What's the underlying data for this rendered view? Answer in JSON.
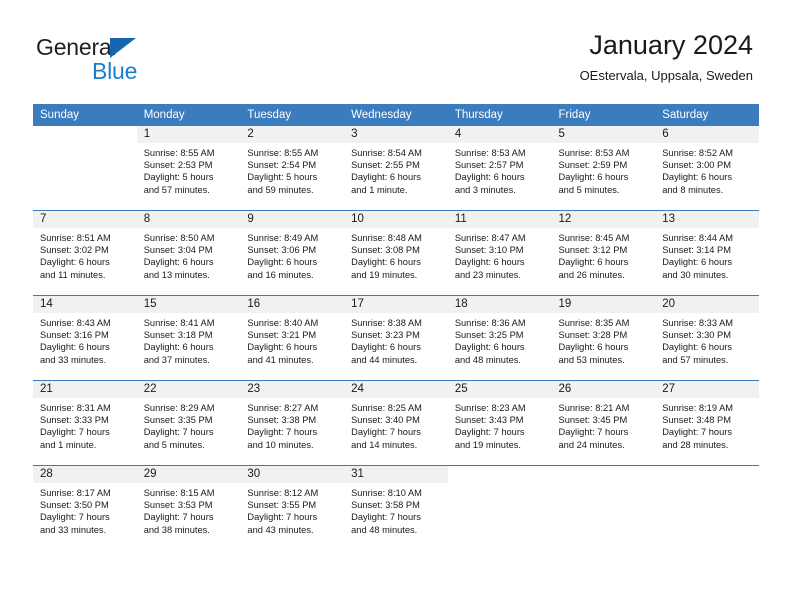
{
  "brand": {
    "name_part1": "General",
    "name_part2": "Blue",
    "triangle_color": "#1565b0",
    "blue_color": "#1b7ec8"
  },
  "header": {
    "title": "January 2024",
    "location": "OEstervala, Uppsala, Sweden"
  },
  "theme": {
    "header_row_bg": "#3a7cbe",
    "header_row_text": "#ffffff",
    "daynum_band_bg": "#f1f1f1",
    "cell_bg": "#ffffff",
    "separator": "#3a7cbe"
  },
  "weekday_headers": [
    "Sunday",
    "Monday",
    "Tuesday",
    "Wednesday",
    "Thursday",
    "Friday",
    "Saturday"
  ],
  "weeks": [
    [
      {
        "day": "",
        "blank": true,
        "sunrise": "",
        "sunset": "",
        "daylight_line1": "",
        "daylight_line2": ""
      },
      {
        "day": "1",
        "sunrise": "Sunrise: 8:55 AM",
        "sunset": "Sunset: 2:53 PM",
        "daylight_line1": "Daylight: 5 hours",
        "daylight_line2": "and 57 minutes."
      },
      {
        "day": "2",
        "sunrise": "Sunrise: 8:55 AM",
        "sunset": "Sunset: 2:54 PM",
        "daylight_line1": "Daylight: 5 hours",
        "daylight_line2": "and 59 minutes."
      },
      {
        "day": "3",
        "sunrise": "Sunrise: 8:54 AM",
        "sunset": "Sunset: 2:55 PM",
        "daylight_line1": "Daylight: 6 hours",
        "daylight_line2": "and 1 minute."
      },
      {
        "day": "4",
        "sunrise": "Sunrise: 8:53 AM",
        "sunset": "Sunset: 2:57 PM",
        "daylight_line1": "Daylight: 6 hours",
        "daylight_line2": "and 3 minutes."
      },
      {
        "day": "5",
        "sunrise": "Sunrise: 8:53 AM",
        "sunset": "Sunset: 2:59 PM",
        "daylight_line1": "Daylight: 6 hours",
        "daylight_line2": "and 5 minutes."
      },
      {
        "day": "6",
        "sunrise": "Sunrise: 8:52 AM",
        "sunset": "Sunset: 3:00 PM",
        "daylight_line1": "Daylight: 6 hours",
        "daylight_line2": "and 8 minutes."
      }
    ],
    [
      {
        "day": "7",
        "sunrise": "Sunrise: 8:51 AM",
        "sunset": "Sunset: 3:02 PM",
        "daylight_line1": "Daylight: 6 hours",
        "daylight_line2": "and 11 minutes."
      },
      {
        "day": "8",
        "sunrise": "Sunrise: 8:50 AM",
        "sunset": "Sunset: 3:04 PM",
        "daylight_line1": "Daylight: 6 hours",
        "daylight_line2": "and 13 minutes."
      },
      {
        "day": "9",
        "sunrise": "Sunrise: 8:49 AM",
        "sunset": "Sunset: 3:06 PM",
        "daylight_line1": "Daylight: 6 hours",
        "daylight_line2": "and 16 minutes."
      },
      {
        "day": "10",
        "sunrise": "Sunrise: 8:48 AM",
        "sunset": "Sunset: 3:08 PM",
        "daylight_line1": "Daylight: 6 hours",
        "daylight_line2": "and 19 minutes."
      },
      {
        "day": "11",
        "sunrise": "Sunrise: 8:47 AM",
        "sunset": "Sunset: 3:10 PM",
        "daylight_line1": "Daylight: 6 hours",
        "daylight_line2": "and 23 minutes."
      },
      {
        "day": "12",
        "sunrise": "Sunrise: 8:45 AM",
        "sunset": "Sunset: 3:12 PM",
        "daylight_line1": "Daylight: 6 hours",
        "daylight_line2": "and 26 minutes."
      },
      {
        "day": "13",
        "sunrise": "Sunrise: 8:44 AM",
        "sunset": "Sunset: 3:14 PM",
        "daylight_line1": "Daylight: 6 hours",
        "daylight_line2": "and 30 minutes."
      }
    ],
    [
      {
        "day": "14",
        "sunrise": "Sunrise: 8:43 AM",
        "sunset": "Sunset: 3:16 PM",
        "daylight_line1": "Daylight: 6 hours",
        "daylight_line2": "and 33 minutes."
      },
      {
        "day": "15",
        "sunrise": "Sunrise: 8:41 AM",
        "sunset": "Sunset: 3:18 PM",
        "daylight_line1": "Daylight: 6 hours",
        "daylight_line2": "and 37 minutes."
      },
      {
        "day": "16",
        "sunrise": "Sunrise: 8:40 AM",
        "sunset": "Sunset: 3:21 PM",
        "daylight_line1": "Daylight: 6 hours",
        "daylight_line2": "and 41 minutes."
      },
      {
        "day": "17",
        "sunrise": "Sunrise: 8:38 AM",
        "sunset": "Sunset: 3:23 PM",
        "daylight_line1": "Daylight: 6 hours",
        "daylight_line2": "and 44 minutes."
      },
      {
        "day": "18",
        "sunrise": "Sunrise: 8:36 AM",
        "sunset": "Sunset: 3:25 PM",
        "daylight_line1": "Daylight: 6 hours",
        "daylight_line2": "and 48 minutes."
      },
      {
        "day": "19",
        "sunrise": "Sunrise: 8:35 AM",
        "sunset": "Sunset: 3:28 PM",
        "daylight_line1": "Daylight: 6 hours",
        "daylight_line2": "and 53 minutes."
      },
      {
        "day": "20",
        "sunrise": "Sunrise: 8:33 AM",
        "sunset": "Sunset: 3:30 PM",
        "daylight_line1": "Daylight: 6 hours",
        "daylight_line2": "and 57 minutes."
      }
    ],
    [
      {
        "day": "21",
        "sunrise": "Sunrise: 8:31 AM",
        "sunset": "Sunset: 3:33 PM",
        "daylight_line1": "Daylight: 7 hours",
        "daylight_line2": "and 1 minute."
      },
      {
        "day": "22",
        "sunrise": "Sunrise: 8:29 AM",
        "sunset": "Sunset: 3:35 PM",
        "daylight_line1": "Daylight: 7 hours",
        "daylight_line2": "and 5 minutes."
      },
      {
        "day": "23",
        "sunrise": "Sunrise: 8:27 AM",
        "sunset": "Sunset: 3:38 PM",
        "daylight_line1": "Daylight: 7 hours",
        "daylight_line2": "and 10 minutes."
      },
      {
        "day": "24",
        "sunrise": "Sunrise: 8:25 AM",
        "sunset": "Sunset: 3:40 PM",
        "daylight_line1": "Daylight: 7 hours",
        "daylight_line2": "and 14 minutes."
      },
      {
        "day": "25",
        "sunrise": "Sunrise: 8:23 AM",
        "sunset": "Sunset: 3:43 PM",
        "daylight_line1": "Daylight: 7 hours",
        "daylight_line2": "and 19 minutes."
      },
      {
        "day": "26",
        "sunrise": "Sunrise: 8:21 AM",
        "sunset": "Sunset: 3:45 PM",
        "daylight_line1": "Daylight: 7 hours",
        "daylight_line2": "and 24 minutes."
      },
      {
        "day": "27",
        "sunrise": "Sunrise: 8:19 AM",
        "sunset": "Sunset: 3:48 PM",
        "daylight_line1": "Daylight: 7 hours",
        "daylight_line2": "and 28 minutes."
      }
    ],
    [
      {
        "day": "28",
        "sunrise": "Sunrise: 8:17 AM",
        "sunset": "Sunset: 3:50 PM",
        "daylight_line1": "Daylight: 7 hours",
        "daylight_line2": "and 33 minutes."
      },
      {
        "day": "29",
        "sunrise": "Sunrise: 8:15 AM",
        "sunset": "Sunset: 3:53 PM",
        "daylight_line1": "Daylight: 7 hours",
        "daylight_line2": "and 38 minutes."
      },
      {
        "day": "30",
        "sunrise": "Sunrise: 8:12 AM",
        "sunset": "Sunset: 3:55 PM",
        "daylight_line1": "Daylight: 7 hours",
        "daylight_line2": "and 43 minutes."
      },
      {
        "day": "31",
        "sunrise": "Sunrise: 8:10 AM",
        "sunset": "Sunset: 3:58 PM",
        "daylight_line1": "Daylight: 7 hours",
        "daylight_line2": "and 48 minutes."
      },
      {
        "day": "",
        "blank": true,
        "sunrise": "",
        "sunset": "",
        "daylight_line1": "",
        "daylight_line2": ""
      },
      {
        "day": "",
        "blank": true,
        "sunrise": "",
        "sunset": "",
        "daylight_line1": "",
        "daylight_line2": ""
      },
      {
        "day": "",
        "blank": true,
        "sunrise": "",
        "sunset": "",
        "daylight_line1": "",
        "daylight_line2": ""
      }
    ]
  ]
}
